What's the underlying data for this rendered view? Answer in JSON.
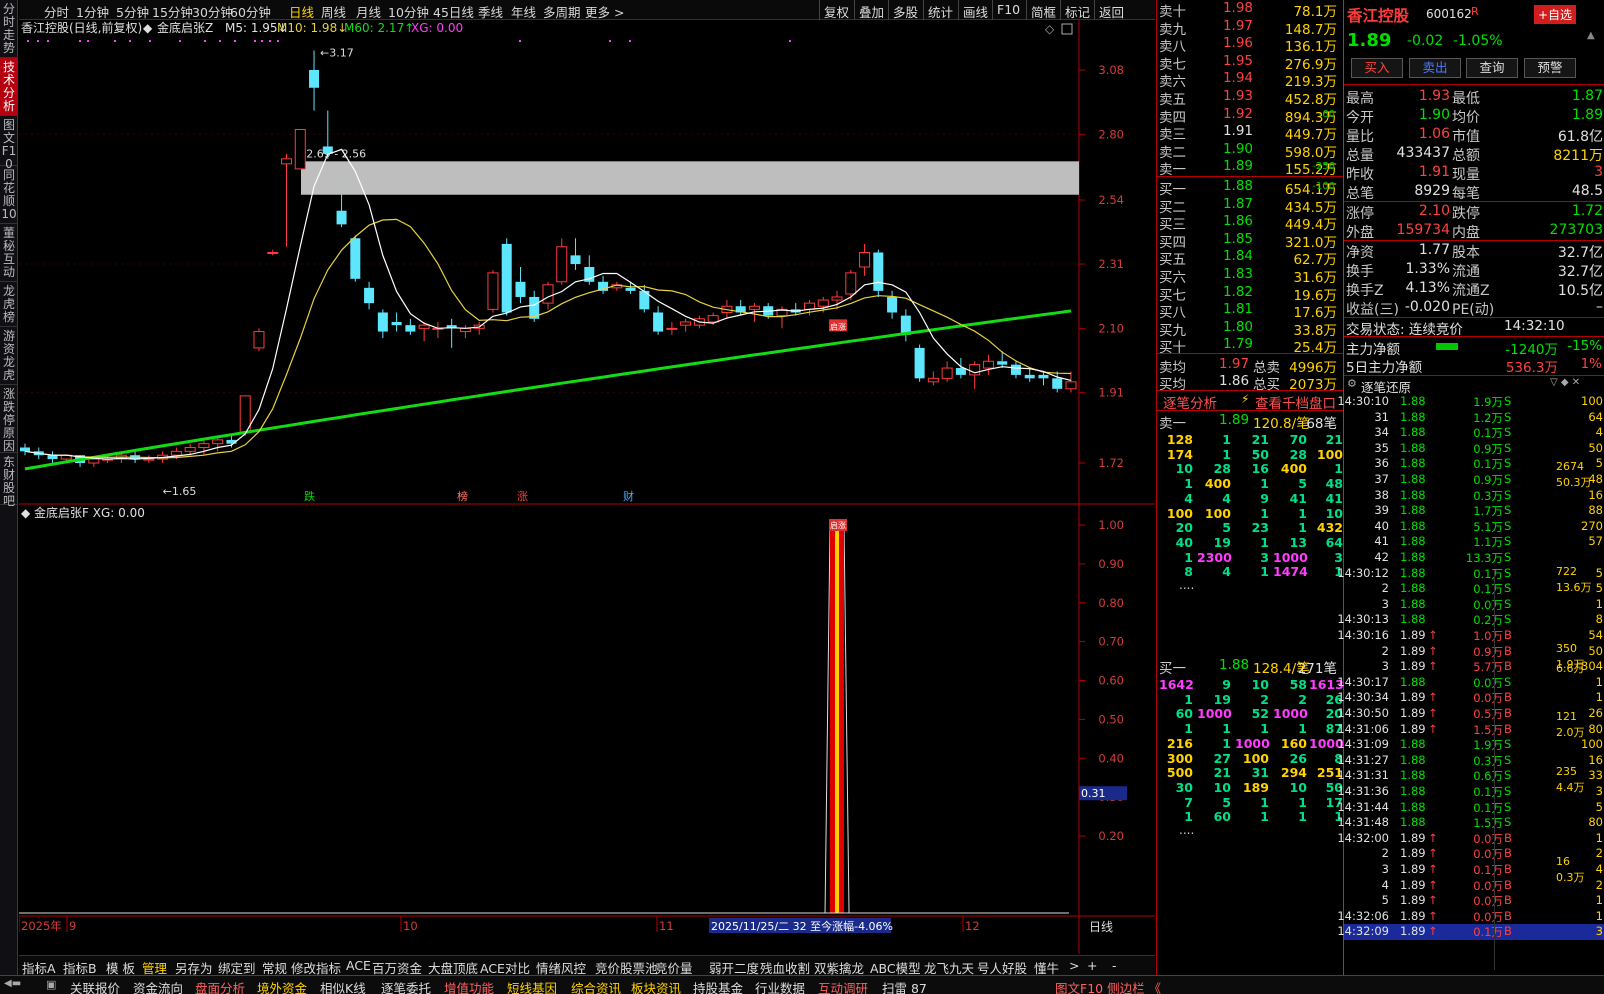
{
  "vtabs": [
    "分时走势",
    "技术分析",
    "图文F10",
    "同花顺10",
    "董秘互动",
    "龙虎榜",
    "游资龙虎",
    "涨跌停原因",
    "东财股吧"
  ],
  "periods": [
    "分时",
    "1分钟",
    "5分钟",
    "15分钟",
    "30分钟",
    "60分钟",
    "日线",
    "周线",
    "月线",
    "10分钟",
    "45日线",
    "季线",
    "年线",
    "多周期",
    "更多 >"
  ],
  "active_period": "日线",
  "top_right": [
    "复权",
    "叠加",
    "多股",
    "统计",
    "画线",
    "F10",
    "简框",
    "标记",
    "返回"
  ],
  "chart": {
    "title": "香江控股(日线,前复权)",
    "indicator_name": "金底启张Z",
    "ma5": "M5: 1.95↓",
    "ma10": "M10: 1.98↓",
    "ma60": "M60: 2.17↑",
    "xg": "XG: 0.00",
    "high_label": "3.17",
    "low_label": "←1.65",
    "zone_label": "2.69 - 2.56",
    "event_labels": [
      "跌",
      "榜",
      "涨",
      "财"
    ],
    "marker_label": "启涨",
    "y_ticks": [
      "3.08",
      "2.80",
      "2.54",
      "2.31",
      "2.10",
      "1.91",
      "1.72"
    ],
    "lower_title": "金底启张F  XG: 0.00",
    "lower_ticks": [
      "1.00",
      "0.90",
      "0.80",
      "0.70",
      "0.60",
      "0.50",
      "0.40",
      "0.30",
      "0.20"
    ],
    "lower_current": "0.31",
    "x_labels": [
      "2025年",
      "9",
      "10",
      "11",
      "12"
    ],
    "x_highlight": "2025/11/25/二 32 至今涨幅-4.06%",
    "x_right": "日线",
    "colors": {
      "up": "#ff3b3b",
      "down": "#5ee6ff",
      "ma5": "#ffffff",
      "ma10": "#e6d23c",
      "ma60": "#14dc14",
      "zone": "#c8c8c8"
    }
  },
  "chart_data": {
    "type": "candlestick",
    "series": [
      [
        1.76,
        1.77,
        1.74,
        1.75
      ],
      [
        1.75,
        1.76,
        1.73,
        1.74
      ],
      [
        1.74,
        1.75,
        1.72,
        1.73
      ],
      [
        1.73,
        1.74,
        1.72,
        1.74
      ],
      [
        1.74,
        1.74,
        1.71,
        1.72
      ],
      [
        1.72,
        1.73,
        1.71,
        1.73
      ],
      [
        1.73,
        1.74,
        1.72,
        1.73
      ],
      [
        1.73,
        1.75,
        1.72,
        1.74
      ],
      [
        1.74,
        1.75,
        1.72,
        1.73
      ],
      [
        1.73,
        1.74,
        1.72,
        1.73
      ],
      [
        1.73,
        1.75,
        1.72,
        1.74
      ],
      [
        1.74,
        1.76,
        1.73,
        1.75
      ],
      [
        1.75,
        1.77,
        1.74,
        1.76
      ],
      [
        1.76,
        1.78,
        1.74,
        1.77
      ],
      [
        1.77,
        1.79,
        1.75,
        1.78
      ],
      [
        1.78,
        1.79,
        1.76,
        1.77
      ],
      [
        1.8,
        1.9,
        1.79,
        1.9
      ],
      [
        2.04,
        2.1,
        2.03,
        2.09
      ],
      [
        2.35,
        2.36,
        2.34,
        2.35
      ],
      [
        2.68,
        2.72,
        2.37,
        2.7
      ],
      [
        2.66,
        2.82,
        2.66,
        2.82
      ],
      [
        3.08,
        3.17,
        2.9,
        3.0
      ],
      [
        2.75,
        2.9,
        2.7,
        2.72
      ],
      [
        2.5,
        2.63,
        2.44,
        2.45
      ],
      [
        2.4,
        2.41,
        2.25,
        2.26
      ],
      [
        2.23,
        2.25,
        2.16,
        2.18
      ],
      [
        2.15,
        2.16,
        2.07,
        2.09
      ],
      [
        2.12,
        2.15,
        2.09,
        2.11
      ],
      [
        2.11,
        2.13,
        2.08,
        2.09
      ],
      [
        2.1,
        2.12,
        2.06,
        2.11
      ],
      [
        2.1,
        2.12,
        2.07,
        2.1
      ],
      [
        2.11,
        2.13,
        2.04,
        2.1
      ],
      [
        2.09,
        2.11,
        2.07,
        2.1
      ],
      [
        2.1,
        2.12,
        2.08,
        2.11
      ],
      [
        2.16,
        2.29,
        2.15,
        2.28
      ],
      [
        2.38,
        2.4,
        2.14,
        2.15
      ],
      [
        2.25,
        2.3,
        2.18,
        2.2
      ],
      [
        2.2,
        2.22,
        2.12,
        2.13
      ],
      [
        2.18,
        2.25,
        2.16,
        2.24
      ],
      [
        2.25,
        2.4,
        2.24,
        2.37
      ],
      [
        2.34,
        2.4,
        2.29,
        2.31
      ],
      [
        2.3,
        2.34,
        2.24,
        2.25
      ],
      [
        2.25,
        2.27,
        2.21,
        2.22
      ],
      [
        2.23,
        2.25,
        2.22,
        2.24
      ],
      [
        2.23,
        2.25,
        2.21,
        2.22
      ],
      [
        2.22,
        2.24,
        2.15,
        2.16
      ],
      [
        2.15,
        2.17,
        2.08,
        2.09
      ],
      [
        2.1,
        2.12,
        2.08,
        2.1
      ],
      [
        2.11,
        2.13,
        2.09,
        2.12
      ],
      [
        2.11,
        2.14,
        2.1,
        2.13
      ],
      [
        2.12,
        2.15,
        2.11,
        2.14
      ],
      [
        2.15,
        2.19,
        2.13,
        2.17
      ],
      [
        2.17,
        2.19,
        2.14,
        2.15
      ],
      [
        2.16,
        2.18,
        2.12,
        2.17
      ],
      [
        2.17,
        2.18,
        2.13,
        2.14
      ],
      [
        2.14,
        2.17,
        2.1,
        2.16
      ],
      [
        2.16,
        2.18,
        2.14,
        2.15
      ],
      [
        2.16,
        2.19,
        2.14,
        2.18
      ],
      [
        2.17,
        2.2,
        2.15,
        2.19
      ],
      [
        2.19,
        2.22,
        2.16,
        2.2
      ],
      [
        2.21,
        2.29,
        2.19,
        2.28
      ],
      [
        2.3,
        2.38,
        2.27,
        2.35
      ],
      [
        2.35,
        2.36,
        2.2,
        2.22
      ],
      [
        2.2,
        2.22,
        2.13,
        2.15
      ],
      [
        2.14,
        2.16,
        2.06,
        2.08
      ],
      [
        2.04,
        2.05,
        1.94,
        1.95
      ],
      [
        1.94,
        1.97,
        1.93,
        1.95
      ],
      [
        1.95,
        2.0,
        1.94,
        1.98
      ],
      [
        1.98,
        2.01,
        1.95,
        1.96
      ],
      [
        1.96,
        2.0,
        1.92,
        1.99
      ],
      [
        1.98,
        2.02,
        1.96,
        2.0
      ],
      [
        2.0,
        2.03,
        1.98,
        1.99
      ],
      [
        1.99,
        2.0,
        1.95,
        1.96
      ],
      [
        1.96,
        1.98,
        1.94,
        1.95
      ],
      [
        1.96,
        1.97,
        1.93,
        1.95
      ],
      [
        1.95,
        1.97,
        1.91,
        1.92
      ],
      [
        1.92,
        1.97,
        1.91,
        1.94
      ]
    ],
    "event_values": [],
    "lower": {
      "series": "金底启张F",
      "spike_date": "2025/11/25",
      "spike_value": 1.0,
      "current": 0.31
    },
    "ylim": [
      1.65,
      3.17
    ]
  },
  "orderbook": {
    "asks": [
      [
        "卖十",
        "1.98",
        "78.1万",
        ""
      ],
      [
        "卖九",
        "1.97",
        "148.7万",
        ""
      ],
      [
        "卖八",
        "1.96",
        "136.1万",
        ""
      ],
      [
        "卖七",
        "1.95",
        "276.9万",
        ""
      ],
      [
        "卖六",
        "1.94",
        "219.3万",
        ""
      ],
      [
        "卖五",
        "1.93",
        "452.8万",
        ""
      ],
      [
        "卖四",
        "1.92",
        "894.3万",
        "-60"
      ],
      [
        "卖三",
        "1.91",
        "449.7万",
        ""
      ],
      [
        "卖二",
        "1.90",
        "598.0万",
        ""
      ],
      [
        "卖一",
        "1.89",
        "155.2万",
        "-256"
      ]
    ],
    "bids": [
      [
        "买一",
        "1.88",
        "654.1万",
        "-100"
      ],
      [
        "买二",
        "1.87",
        "434.5万",
        ""
      ],
      [
        "买三",
        "1.86",
        "449.4万",
        ""
      ],
      [
        "买四",
        "1.85",
        "321.0万",
        ""
      ],
      [
        "买五",
        "1.84",
        "62.7万",
        ""
      ],
      [
        "买六",
        "1.83",
        "31.6万",
        ""
      ],
      [
        "买七",
        "1.82",
        "19.6万",
        ""
      ],
      [
        "买八",
        "1.81",
        "17.6万",
        ""
      ],
      [
        "买九",
        "1.80",
        "33.8万",
        ""
      ],
      [
        "买十",
        "1.79",
        "25.4万",
        ""
      ]
    ],
    "avg_sell": [
      "卖均",
      "1.97",
      "总卖",
      "4996万"
    ],
    "avg_buy": [
      "买均",
      "1.86",
      "总买",
      "2073万"
    ],
    "tick_analysis": "逐笔分析",
    "thousand_link": "查看千档盘口",
    "sell1_summary": [
      "卖一",
      "1.89",
      "120.8/笔",
      "68笔"
    ],
    "sell1_grid": [
      [
        "128",
        "1",
        "21",
        "70",
        "21"
      ],
      [
        "174",
        "1",
        "50",
        "28",
        "100"
      ],
      [
        "10",
        "28",
        "16",
        "400",
        "1"
      ],
      [
        "1",
        "400",
        "1",
        "5",
        "48"
      ],
      [
        "4",
        "4",
        "9",
        "41",
        "41"
      ],
      [
        "100",
        "100",
        "1",
        "1",
        "10"
      ],
      [
        "20",
        "5",
        "23",
        "1",
        "432"
      ],
      [
        "40",
        "19",
        "1",
        "13",
        "64"
      ],
      [
        "1",
        "2300",
        "3",
        "1000",
        "3"
      ],
      [
        "8",
        "4",
        "1",
        "1474",
        "1"
      ]
    ],
    "buy1_summary": [
      "买一",
      "1.88",
      "128.4/笔",
      "271笔"
    ],
    "buy1_grid": [
      [
        "1642",
        "9",
        "10",
        "58",
        "1613"
      ],
      [
        "1",
        "19",
        "2",
        "2",
        "26"
      ],
      [
        "60",
        "1000",
        "52",
        "1000",
        "20"
      ],
      [
        "1",
        "1",
        "1",
        "1",
        "87"
      ],
      [
        "216",
        "1",
        "1000",
        "160",
        "1000"
      ],
      [
        "300",
        "27",
        "100",
        "26",
        "8"
      ],
      [
        "500",
        "21",
        "31",
        "294",
        "251"
      ],
      [
        "30",
        "10",
        "189",
        "10",
        "50"
      ],
      [
        "7",
        "5",
        "1",
        "1",
        "17"
      ],
      [
        "1",
        "60",
        "1",
        "1",
        "1"
      ]
    ],
    "ellipsis": "....",
    "tabs": [
      "队列",
      "分布",
      "龙虎"
    ]
  },
  "quote": {
    "name": "香江控股",
    "code": "600162",
    "flag": "R",
    "add_btn": "+自选",
    "price": "1.89",
    "change": "-0.02",
    "pct": "-1.05%",
    "buttons": [
      "买入",
      "卖出",
      "查询",
      "预警"
    ],
    "rows": [
      [
        "最高",
        "1.93",
        "最低",
        "1.87"
      ],
      [
        "今开",
        "1.90",
        "均价",
        "1.89"
      ],
      [
        "量比",
        "1.06",
        "市值",
        "61.8亿"
      ],
      [
        "总量",
        "433437",
        "总额",
        "8211万"
      ],
      [
        "昨收",
        "1.91",
        "现量",
        "3"
      ],
      [
        "总笔",
        "8929",
        "每笔",
        "48.5"
      ],
      [
        "涨停",
        "2.10",
        "跌停",
        "1.72"
      ],
      [
        "外盘",
        "159734",
        "内盘",
        "273703"
      ],
      [
        "净资",
        "1.77",
        "股本",
        "32.7亿"
      ],
      [
        "换手",
        "1.33%",
        "流通",
        "32.7亿"
      ],
      [
        "换手Z",
        "4.13%",
        "流通Z",
        "10.5亿"
      ],
      [
        "收益(三)",
        "-0.020",
        "PE(动)",
        "–"
      ]
    ],
    "trade_status": "交易状态: 连续竞价",
    "trade_time": "14:32:10",
    "main_net": [
      "主力净额",
      "-1240万",
      "-15%"
    ],
    "main_net5": [
      "5日主力净额",
      "536.3万",
      "1%"
    ],
    "ticks_title": "逐笔还原",
    "ticks": [
      [
        "14:30:10",
        "1.88",
        "1.9万S",
        "100"
      ],
      [
        "31",
        "1.88",
        "1.2万S",
        "64"
      ],
      [
        "34",
        "1.88",
        "0.1万S",
        "4"
      ],
      [
        "35",
        "1.88",
        "0.9万S",
        "50"
      ],
      [
        "36",
        "1.88",
        "0.1万S",
        "5"
      ],
      [
        "37",
        "1.88",
        "0.9万S",
        "48"
      ],
      [
        "38",
        "1.88",
        "0.3万S",
        "16"
      ],
      [
        "39",
        "1.88",
        "1.7万S",
        "88"
      ],
      [
        "40",
        "1.88",
        "5.1万S",
        "270"
      ],
      [
        "41",
        "1.88",
        "1.1万S",
        "57"
      ],
      [
        "42",
        "1.88",
        "13.3万S",
        ""
      ],
      [
        "14:30:12",
        "1.88",
        "0.1万S",
        "5"
      ],
      [
        "2",
        "1.88",
        "0.1万S",
        "5"
      ],
      [
        "3",
        "1.88",
        "0.0万S",
        "1"
      ],
      [
        "14:30:13",
        "1.88",
        "0.2万S",
        "8"
      ],
      [
        "14:30:16",
        "1.89",
        "1.0万B",
        "54"
      ],
      [
        "2",
        "1.89",
        "0.9万B",
        "50"
      ],
      [
        "3",
        "1.89",
        "5.7万B",
        "304"
      ],
      [
        "14:30:17",
        "1.88",
        "0.0万S",
        "1"
      ],
      [
        "14:30:34",
        "1.89",
        "0.0万B",
        "1"
      ],
      [
        "14:30:50",
        "1.89",
        "0.5万B",
        "26"
      ],
      [
        "14:31:06",
        "1.89",
        "1.5万B",
        "80"
      ],
      [
        "14:31:09",
        "1.88",
        "1.9万S",
        "100"
      ],
      [
        "14:31:27",
        "1.88",
        "0.3万S",
        "16"
      ],
      [
        "14:31:31",
        "1.88",
        "0.6万S",
        "33"
      ],
      [
        "14:31:36",
        "1.88",
        "0.1万S",
        "3"
      ],
      [
        "14:31:44",
        "1.88",
        "0.1万S",
        "5"
      ],
      [
        "14:31:48",
        "1.88",
        "1.5万S",
        "80"
      ],
      [
        "14:32:00",
        "1.89",
        "0.0万B",
        "1"
      ],
      [
        "2",
        "1.89",
        "0.0万B",
        "2"
      ],
      [
        "3",
        "1.89",
        "0.1万B",
        "4"
      ],
      [
        "4",
        "1.89",
        "0.0万B",
        "2"
      ],
      [
        "5",
        "1.89",
        "0.0万B",
        "1"
      ],
      [
        "14:32:06",
        "1.89",
        "0.0万B",
        "1"
      ],
      [
        "14:32:09",
        "1.89",
        "0.1万B",
        "3"
      ]
    ],
    "agg": [
      [
        "2674",
        "50.3万"
      ],
      [
        "722",
        "13.6万"
      ],
      [
        "350",
        "1.9万"
      ],
      [
        "6.6万",
        ""
      ],
      [
        "121",
        "2.0万"
      ],
      [
        "235",
        "4.4万"
      ],
      [
        "16",
        "0.3万"
      ]
    ],
    "tabs": [
      "笔",
      "价",
      "细",
      "分",
      "势",
      "指",
      "联",
      "值",
      "主",
      "逆",
      "筹"
    ]
  },
  "indicator_tabs": [
    "指标A",
    "指标B",
    "模 板",
    "管理",
    "另存为",
    "绑定到",
    "常规",
    "修改指标",
    "ACE",
    "百万资金",
    "大盘顶底",
    "ACE对比",
    "情绪风控",
    "竞价股票池",
    "竞价量",
    "弱开二度",
    "残血收割",
    "双紫擒龙",
    "ABC模型",
    "龙飞九天",
    "号人好股",
    "懂牛"
  ],
  "status": [
    "关联报价",
    "资金流向",
    "盘面分析",
    "境外资金",
    "相似K线",
    "逐笔委托",
    "增值功能",
    "短线基因",
    "综合资讯",
    "板块资讯",
    "持股基金",
    "行业数据",
    "互动调研",
    "扫雷 87"
  ],
  "status_right": "图文F10 侧边栏 《"
}
